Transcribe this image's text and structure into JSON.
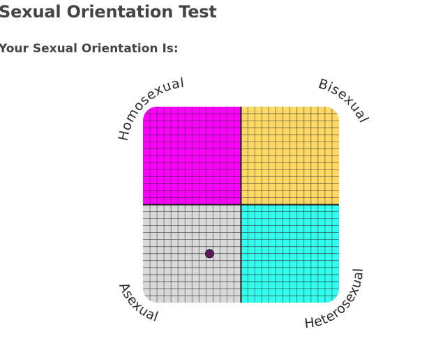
{
  "page": {
    "title": "Sexual Orientation Test",
    "result_heading": "Your Sexual Orientation Is:"
  },
  "chart_data": {
    "type": "scatter",
    "quadrants": [
      {
        "label": "Homosexual",
        "position": "top-left",
        "color": "#ff00ff"
      },
      {
        "label": "Bisexual",
        "position": "top-right",
        "color": "#ffd966"
      },
      {
        "label": "Asexual",
        "position": "bottom-left",
        "color": "#d9d9d9"
      },
      {
        "label": "Heterosexual",
        "position": "bottom-right",
        "color": "#33ffee"
      }
    ],
    "grid": true,
    "grid_divisions": 14,
    "point": {
      "x": -0.32,
      "y": -0.5,
      "color": "#5b1a5c"
    },
    "xlim": [
      -1,
      1
    ],
    "ylim": [
      -1,
      1
    ]
  }
}
